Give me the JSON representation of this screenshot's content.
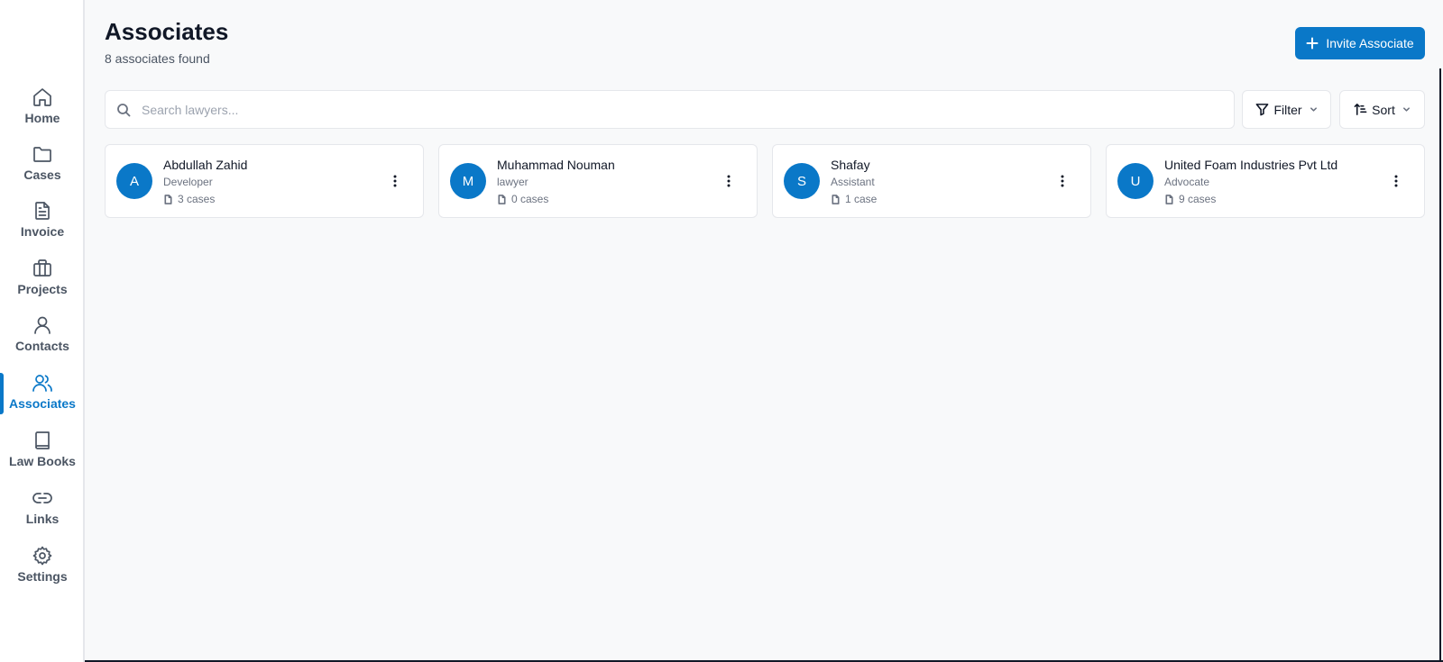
{
  "sidebar": {
    "items": [
      {
        "label": "Home",
        "icon": "home-icon",
        "active": false
      },
      {
        "label": "Cases",
        "icon": "folder-icon",
        "active": false
      },
      {
        "label": "Invoice",
        "icon": "document-icon",
        "active": false
      },
      {
        "label": "Projects",
        "icon": "briefcase-icon",
        "active": false
      },
      {
        "label": "Contacts",
        "icon": "user-icon",
        "active": false
      },
      {
        "label": "Associates",
        "icon": "users-icon",
        "active": true
      },
      {
        "label": "Law Books",
        "icon": "book-icon",
        "active": false
      },
      {
        "label": "Links",
        "icon": "link-icon",
        "active": false
      },
      {
        "label": "Settings",
        "icon": "gear-icon",
        "active": false
      }
    ]
  },
  "header": {
    "title": "Associates",
    "subtitle": "8 associates found",
    "invite_label": "Invite Associate"
  },
  "search": {
    "placeholder": "Search lawyers...",
    "value": ""
  },
  "toolbar": {
    "filter_label": "Filter",
    "sort_label": "Sort"
  },
  "associates": [
    {
      "initial": "A",
      "name": "Abdullah Zahid",
      "role": "Developer",
      "cases": "3 cases"
    },
    {
      "initial": "M",
      "name": "Muhammad Nouman",
      "role": "lawyer",
      "cases": "0 cases"
    },
    {
      "initial": "S",
      "name": "Shafay",
      "role": "Assistant",
      "cases": "1 case"
    },
    {
      "initial": "U",
      "name": "United Foam Industries Pvt Ltd",
      "role": "Advocate",
      "cases": "9 cases"
    }
  ],
  "colors": {
    "accent": "#0a78c8",
    "background": "#f8f9fa",
    "card": "#ffffff"
  }
}
